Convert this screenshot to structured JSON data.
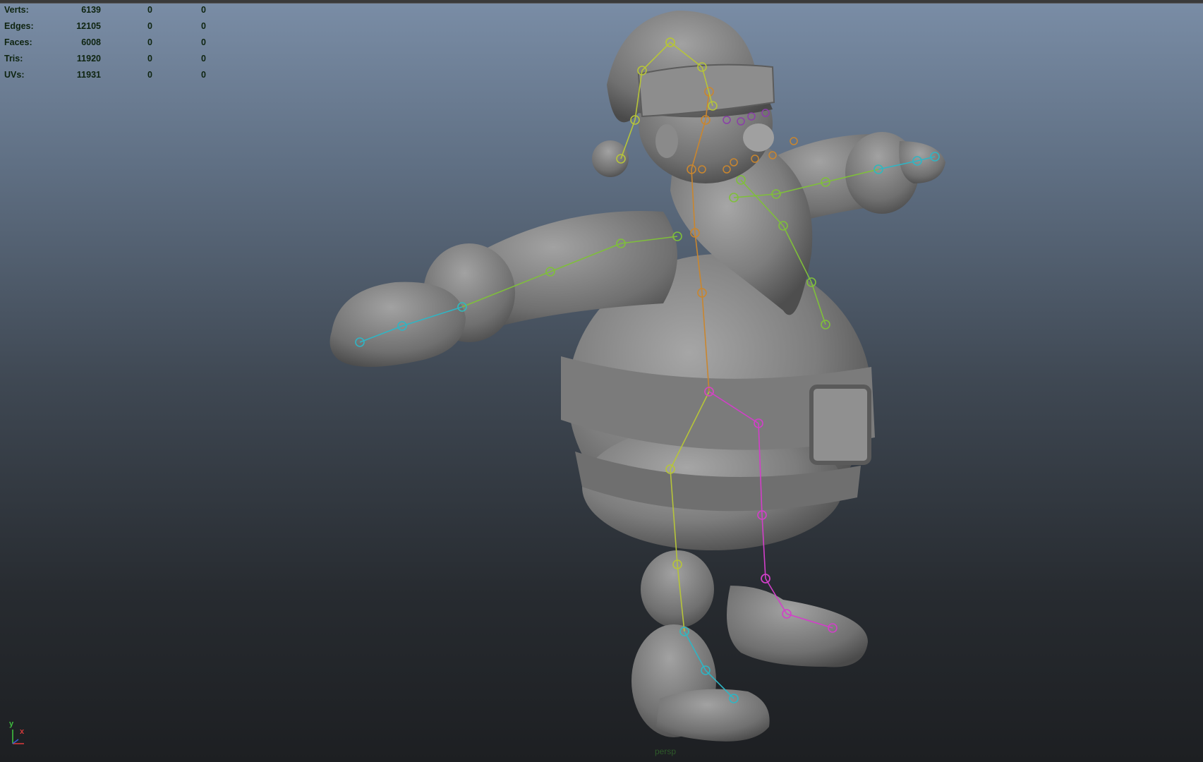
{
  "heads_up_display": {
    "rows": [
      {
        "label": "Verts:",
        "values": [
          "6139",
          "0",
          "0"
        ]
      },
      {
        "label": "Edges:",
        "values": [
          "12105",
          "0",
          "0"
        ]
      },
      {
        "label": "Faces:",
        "values": [
          "6008",
          "0",
          "0"
        ]
      },
      {
        "label": "Tris:",
        "values": [
          "11920",
          "0",
          "0"
        ]
      },
      {
        "label": "UVs:",
        "values": [
          "11931",
          "0",
          "0"
        ]
      }
    ]
  },
  "view_axis": {
    "y_label": "y",
    "x_label": "x"
  },
  "camera": {
    "name": "persp"
  },
  "colors": {
    "model": "#8a8a8a",
    "spine_joints": "#c9862f",
    "left_arm_joints": "#7fbf3a",
    "right_leg_joints": "#d23fc9",
    "left_leg_joints": "#b6c43a",
    "hand_joints": "#2fb5c4"
  }
}
